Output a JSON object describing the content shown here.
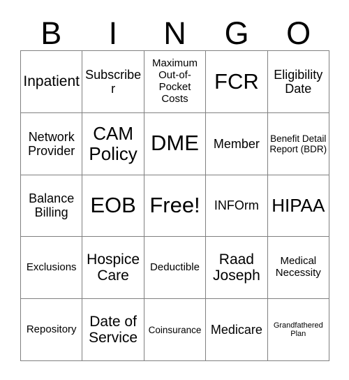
{
  "card": {
    "title": "BINGO",
    "header_letters": [
      "B",
      "I",
      "N",
      "G",
      "O"
    ],
    "grid": {
      "columns": 5,
      "rows": 5,
      "line_color": "#808080",
      "background": "#ffffff",
      "text_color": "#000000"
    },
    "cells": [
      {
        "text": "Inpatient",
        "size": "l",
        "row": 1,
        "col": 1,
        "column_letter": "B",
        "free": false
      },
      {
        "text": "Subscriber",
        "size": "m",
        "row": 1,
        "col": 2,
        "column_letter": "I",
        "free": false
      },
      {
        "text": "Maximum Out-of-Pocket Costs",
        "size": "s",
        "row": 1,
        "col": 3,
        "column_letter": "N",
        "free": false
      },
      {
        "text": "FCR",
        "size": "xxl",
        "row": 1,
        "col": 4,
        "column_letter": "G",
        "free": false
      },
      {
        "text": "Eligibility Date",
        "size": "m",
        "row": 1,
        "col": 5,
        "column_letter": "O",
        "free": false
      },
      {
        "text": "Network Provider",
        "size": "m",
        "row": 2,
        "col": 1,
        "column_letter": "B",
        "free": false
      },
      {
        "text": "CAM Policy",
        "size": "xl",
        "row": 2,
        "col": 2,
        "column_letter": "I",
        "free": false
      },
      {
        "text": "DME",
        "size": "xxl",
        "row": 2,
        "col": 3,
        "column_letter": "N",
        "free": false
      },
      {
        "text": "Member",
        "size": "m",
        "row": 2,
        "col": 4,
        "column_letter": "G",
        "free": false
      },
      {
        "text": "Benefit Detail Report (BDR)",
        "size": "xs",
        "row": 2,
        "col": 5,
        "column_letter": "O",
        "free": false
      },
      {
        "text": "Balance Billing",
        "size": "m",
        "row": 3,
        "col": 1,
        "column_letter": "B",
        "free": false
      },
      {
        "text": "EOB",
        "size": "xxl",
        "row": 3,
        "col": 2,
        "column_letter": "I",
        "free": false
      },
      {
        "text": "Free!",
        "size": "xxl",
        "row": 3,
        "col": 3,
        "column_letter": "N",
        "free": true
      },
      {
        "text": "INFOrm",
        "size": "m",
        "row": 3,
        "col": 4,
        "column_letter": "G",
        "free": false
      },
      {
        "text": "HIPAA",
        "size": "xl",
        "row": 3,
        "col": 5,
        "column_letter": "O",
        "free": false
      },
      {
        "text": "Exclusions",
        "size": "s",
        "row": 4,
        "col": 1,
        "column_letter": "B",
        "free": false
      },
      {
        "text": "Hospice Care",
        "size": "l",
        "row": 4,
        "col": 2,
        "column_letter": "I",
        "free": false
      },
      {
        "text": "Deductible",
        "size": "s",
        "row": 4,
        "col": 3,
        "column_letter": "N",
        "free": false
      },
      {
        "text": "Raad Joseph",
        "size": "l",
        "row": 4,
        "col": 4,
        "column_letter": "G",
        "free": false
      },
      {
        "text": "Medical Necessity",
        "size": "s",
        "row": 4,
        "col": 5,
        "column_letter": "O",
        "free": false
      },
      {
        "text": "Repository",
        "size": "s",
        "row": 5,
        "col": 1,
        "column_letter": "B",
        "free": false
      },
      {
        "text": "Date of Service",
        "size": "l",
        "row": 5,
        "col": 2,
        "column_letter": "I",
        "free": false
      },
      {
        "text": "Coinsurance",
        "size": "xs",
        "row": 5,
        "col": 3,
        "column_letter": "N",
        "free": false
      },
      {
        "text": "Medicare",
        "size": "m",
        "row": 5,
        "col": 4,
        "column_letter": "G",
        "free": false
      },
      {
        "text": "Grandfathered Plan",
        "size": "xxs",
        "row": 5,
        "col": 5,
        "column_letter": "O",
        "free": false
      }
    ]
  }
}
